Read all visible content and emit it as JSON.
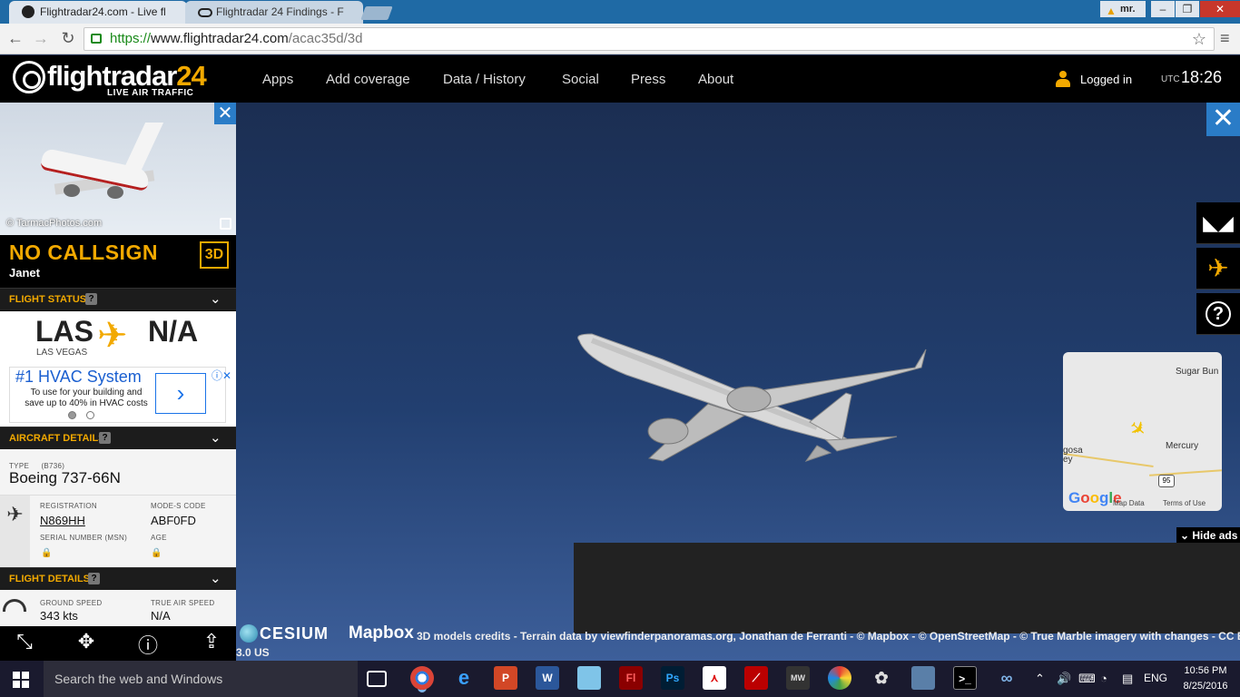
{
  "browser": {
    "tabs": [
      {
        "title": "Flightradar24.com - Live fl",
        "active": true
      },
      {
        "title": "Flightradar 24 Findings - F",
        "active": false
      }
    ],
    "profile": "mr.",
    "window_controls": [
      "–",
      "❐",
      "✕"
    ],
    "url_scheme": "https://",
    "url_host": "www.flightradar24.com",
    "url_path": "/acac35d/3d"
  },
  "header": {
    "logo_prefix": "flightradar",
    "logo_number": "24",
    "logo_sub": "LIVE AIR TRAFFIC",
    "nav": [
      "Apps",
      "Add coverage",
      "Data / History",
      "Social",
      "Press",
      "About"
    ],
    "user_status": "Logged in",
    "tz": "UTC",
    "time": "18:26"
  },
  "sidebar": {
    "photo_credit": "© TarmacPhotos.com",
    "callsign": "NO CALLSIGN",
    "airline": "Janet",
    "btn_3d": "3D",
    "flight_status": {
      "title": "FLIGHT STATUS",
      "from_code": "LAS",
      "from_city": "LAS VEGAS",
      "to_code": "N/A"
    },
    "ad": {
      "title": "#1 HVAC System",
      "line1": "To use for your building and",
      "line2": "save up to 40% in HVAC costs",
      "arrow": "›",
      "close": "ⓘ✕"
    },
    "aircraft_details": {
      "title": "AIRCRAFT DETAILS",
      "type_label": "TYPE",
      "type_code": "(B736)",
      "type_value": "Boeing 737-66N",
      "registration_label": "REGISTRATION",
      "registration": "N869HH",
      "modes_label": "MODE-S CODE",
      "modes": "ABF0FD",
      "serial_label": "SERIAL NUMBER (MSN)",
      "age_label": "AGE"
    },
    "flight_details": {
      "title": "FLIGHT DETAILS",
      "ground_speed_label": "GROUND SPEED",
      "ground_speed": "343 kts",
      "true_air_speed_label": "TRUE AIR SPEED",
      "true_air_speed": "N/A"
    }
  },
  "map": {
    "labels": [
      "Sugar Bun",
      "Mercury",
      "gosa",
      "ey"
    ],
    "shield": "95",
    "google": [
      "G",
      "o",
      "o",
      "g",
      "l",
      "e"
    ],
    "map_data": "Map Data",
    "terms": "Terms of Use"
  },
  "view": {
    "hide_ads": "Hide ads",
    "cesium": "CESIUM",
    "mapbox": "Mapbox",
    "credits": "3D models credits - Terrain data by viewfinderpanoramas.org, Jonathan de Ferranti - © Mapbox - © OpenStreetMap - © True Marble imagery with changes - CC BY",
    "credits2": "3.0 US"
  },
  "taskbar": {
    "search_placeholder": "Search the web and Windows",
    "lang": "ENG",
    "time": "10:56 PM",
    "date": "8/25/2016"
  },
  "colors": {
    "accent": "#f2a900",
    "sky": "#223f70",
    "button_blue": "#2a7cc7"
  }
}
